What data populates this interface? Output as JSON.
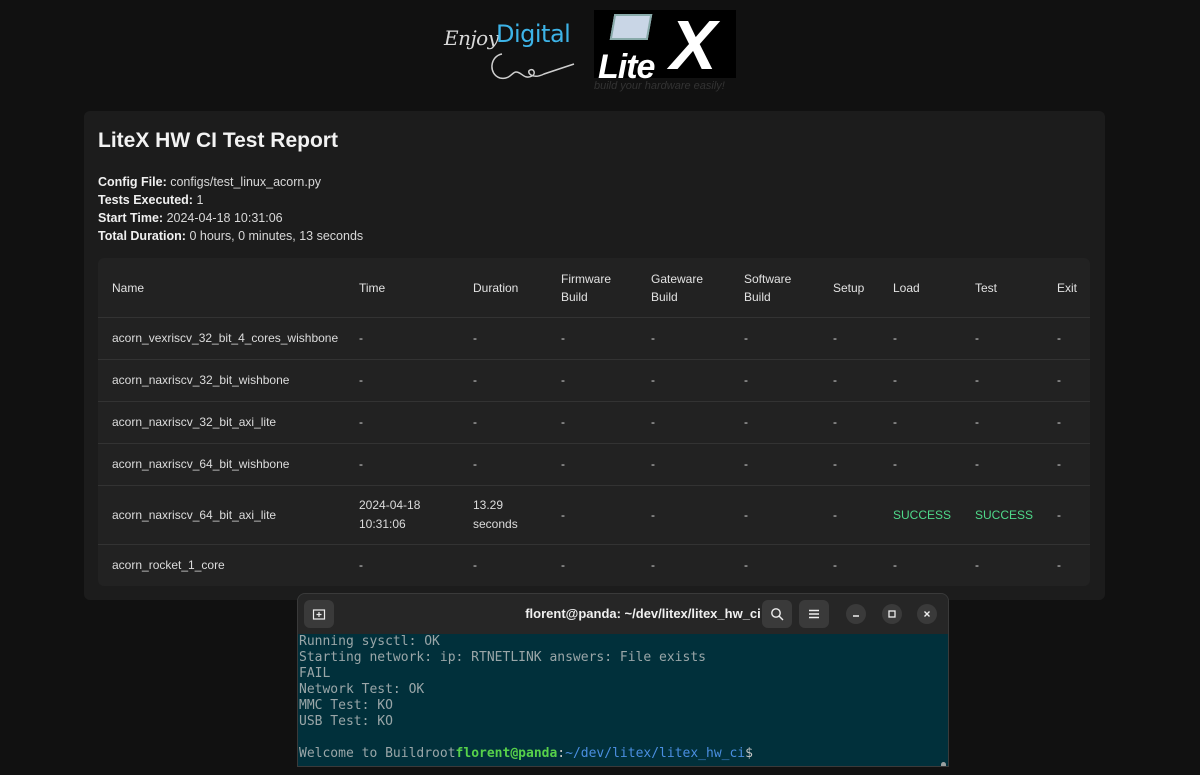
{
  "logos": {
    "enjoy_part1": "Enjoy",
    "enjoy_part2": "Digital",
    "litex_text": "Lite",
    "litex_x": "X",
    "litex_tagline": "build your hardware easily!"
  },
  "report": {
    "title": "LiteX HW CI Test Report",
    "meta": [
      {
        "label": "Config File:",
        "value": "configs/test_linux_acorn.py"
      },
      {
        "label": "Tests Executed:",
        "value": "1"
      },
      {
        "label": "Start Time:",
        "value": "2024-04-18 10:31:06"
      },
      {
        "label": "Total Duration:",
        "value": "0 hours, 0 minutes, 13 seconds"
      }
    ],
    "columns": [
      [
        "Name"
      ],
      [
        "Time"
      ],
      [
        "Duration"
      ],
      [
        "Firmware",
        "Build"
      ],
      [
        "Gateware",
        "Build"
      ],
      [
        "Software",
        "Build"
      ],
      [
        "Setup"
      ],
      [
        "Load"
      ],
      [
        "Test"
      ],
      [
        "Exit"
      ]
    ],
    "rows": [
      {
        "name": "acorn_vexriscv_32_bit_4_cores_wishbone",
        "time": [
          "-"
        ],
        "duration": [
          "-"
        ],
        "firmware": "-",
        "gateware": "-",
        "software": "-",
        "setup": "-",
        "load": "-",
        "test": "-",
        "exit": "-"
      },
      {
        "name": "acorn_naxriscv_32_bit_wishbone",
        "time": [
          "-"
        ],
        "duration": [
          "-"
        ],
        "firmware": "-",
        "gateware": "-",
        "software": "-",
        "setup": "-",
        "load": "-",
        "test": "-",
        "exit": "-"
      },
      {
        "name": "acorn_naxriscv_32_bit_axi_lite",
        "time": [
          "-"
        ],
        "duration": [
          "-"
        ],
        "firmware": "-",
        "gateware": "-",
        "software": "-",
        "setup": "-",
        "load": "-",
        "test": "-",
        "exit": "-"
      },
      {
        "name": "acorn_naxriscv_64_bit_wishbone",
        "time": [
          "-"
        ],
        "duration": [
          "-"
        ],
        "firmware": "-",
        "gateware": "-",
        "software": "-",
        "setup": "-",
        "load": "-",
        "test": "-",
        "exit": "-"
      },
      {
        "name": "acorn_naxriscv_64_bit_axi_lite",
        "time": [
          "2024-04-18",
          "10:31:06"
        ],
        "duration": [
          "13.29",
          "seconds"
        ],
        "firmware": "-",
        "gateware": "-",
        "software": "-",
        "setup": "-",
        "load": "SUCCESS",
        "test": "SUCCESS",
        "exit": "-"
      },
      {
        "name": "acorn_rocket_1_core",
        "time": [
          "-"
        ],
        "duration": [
          "-"
        ],
        "firmware": "-",
        "gateware": "-",
        "software": "-",
        "setup": "-",
        "load": "-",
        "test": "-",
        "exit": "-"
      }
    ],
    "status_colors": {
      "success": "#4fd98a"
    }
  },
  "terminal": {
    "title": "florent@panda: ~/dev/litex/litex_hw_ci",
    "icons": [
      "new-tab-icon",
      "search-icon",
      "menu-icon",
      "minimize-icon",
      "maximize-icon",
      "close-icon"
    ],
    "lines": [
      "Running sysctl: OK",
      "Starting network: ip: RTNETLINK answers: File exists",
      "FAIL",
      "Network Test: OK",
      "MMC Test: KO",
      "USB Test: KO",
      ""
    ],
    "prompt": {
      "prefix": "Welcome to Buildroot",
      "user": "florent@panda",
      "sep": ":",
      "path": "~/dev/litex/litex_hw_ci",
      "symbol": "$"
    }
  }
}
